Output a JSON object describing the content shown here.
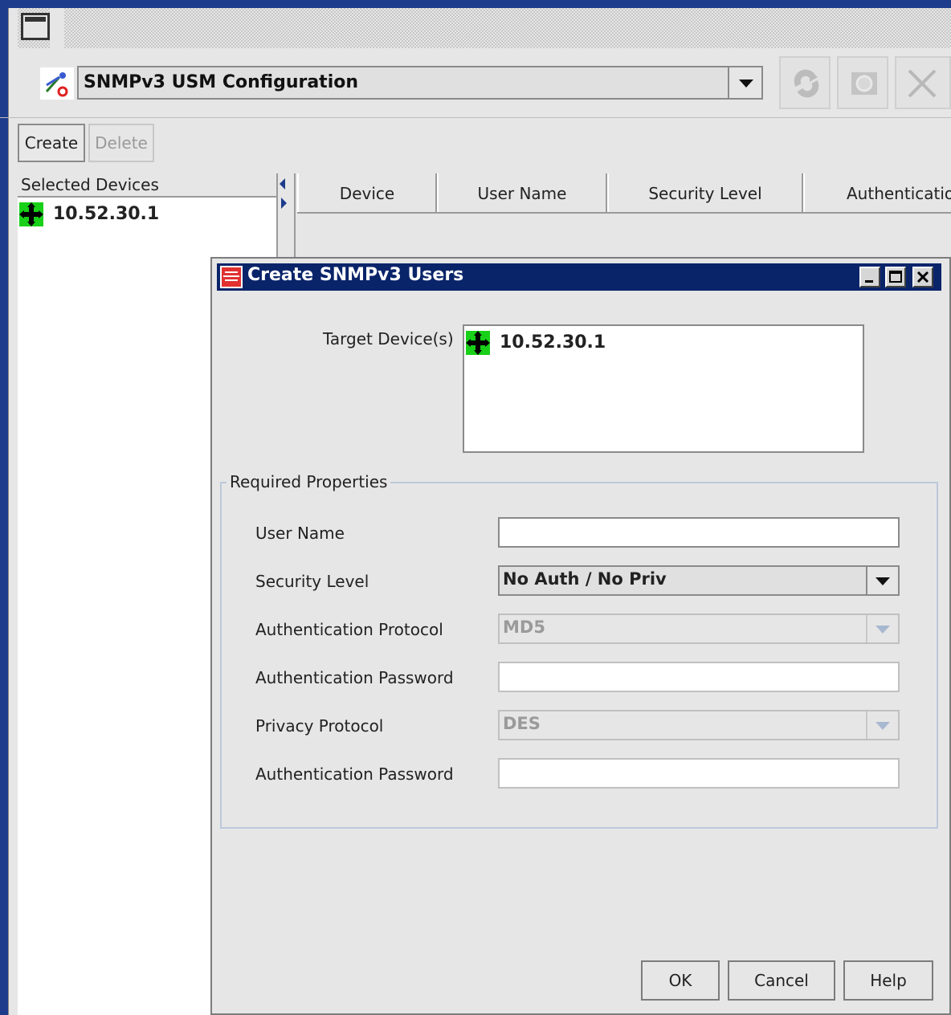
{
  "window": {
    "panel_selector": {
      "value": "SNMPv3 USM Configuration"
    },
    "toolbar": {
      "refresh_icon": "refresh-icon",
      "camera_icon": "camera-icon",
      "close_icon": "close-icon"
    },
    "actions": {
      "create_label": "Create",
      "delete_label": "Delete"
    }
  },
  "selected_devices": {
    "header": "Selected Devices",
    "items": [
      {
        "icon": "device-node-icon",
        "label": "10.52.30.1"
      }
    ]
  },
  "table": {
    "columns": [
      "Device",
      "User Name",
      "Security Level",
      "Authentication"
    ]
  },
  "dialog": {
    "title": "Create SNMPv3 Users",
    "target_label": "Target Device(s)",
    "target_devices": [
      {
        "icon": "device-node-icon",
        "label": "10.52.30.1"
      }
    ],
    "required_legend": "Required Properties",
    "fields": {
      "user_name": {
        "label": "User Name",
        "value": ""
      },
      "security_level": {
        "label": "Security Level",
        "value": "No Auth / No Priv"
      },
      "auth_protocol": {
        "label": "Authentication Protocol",
        "value": "MD5"
      },
      "auth_password": {
        "label": "Authentication Password",
        "value": ""
      },
      "privacy_protocol": {
        "label": "Privacy Protocol",
        "value": "DES"
      },
      "privacy_password": {
        "label": "Authentication Password",
        "value": ""
      }
    },
    "buttons": {
      "ok": "OK",
      "cancel": "Cancel",
      "help": "Help"
    }
  },
  "colors": {
    "title_bar": "#0a246a",
    "device_icon": "#18d018",
    "window_bg": "#e6e6e6"
  }
}
